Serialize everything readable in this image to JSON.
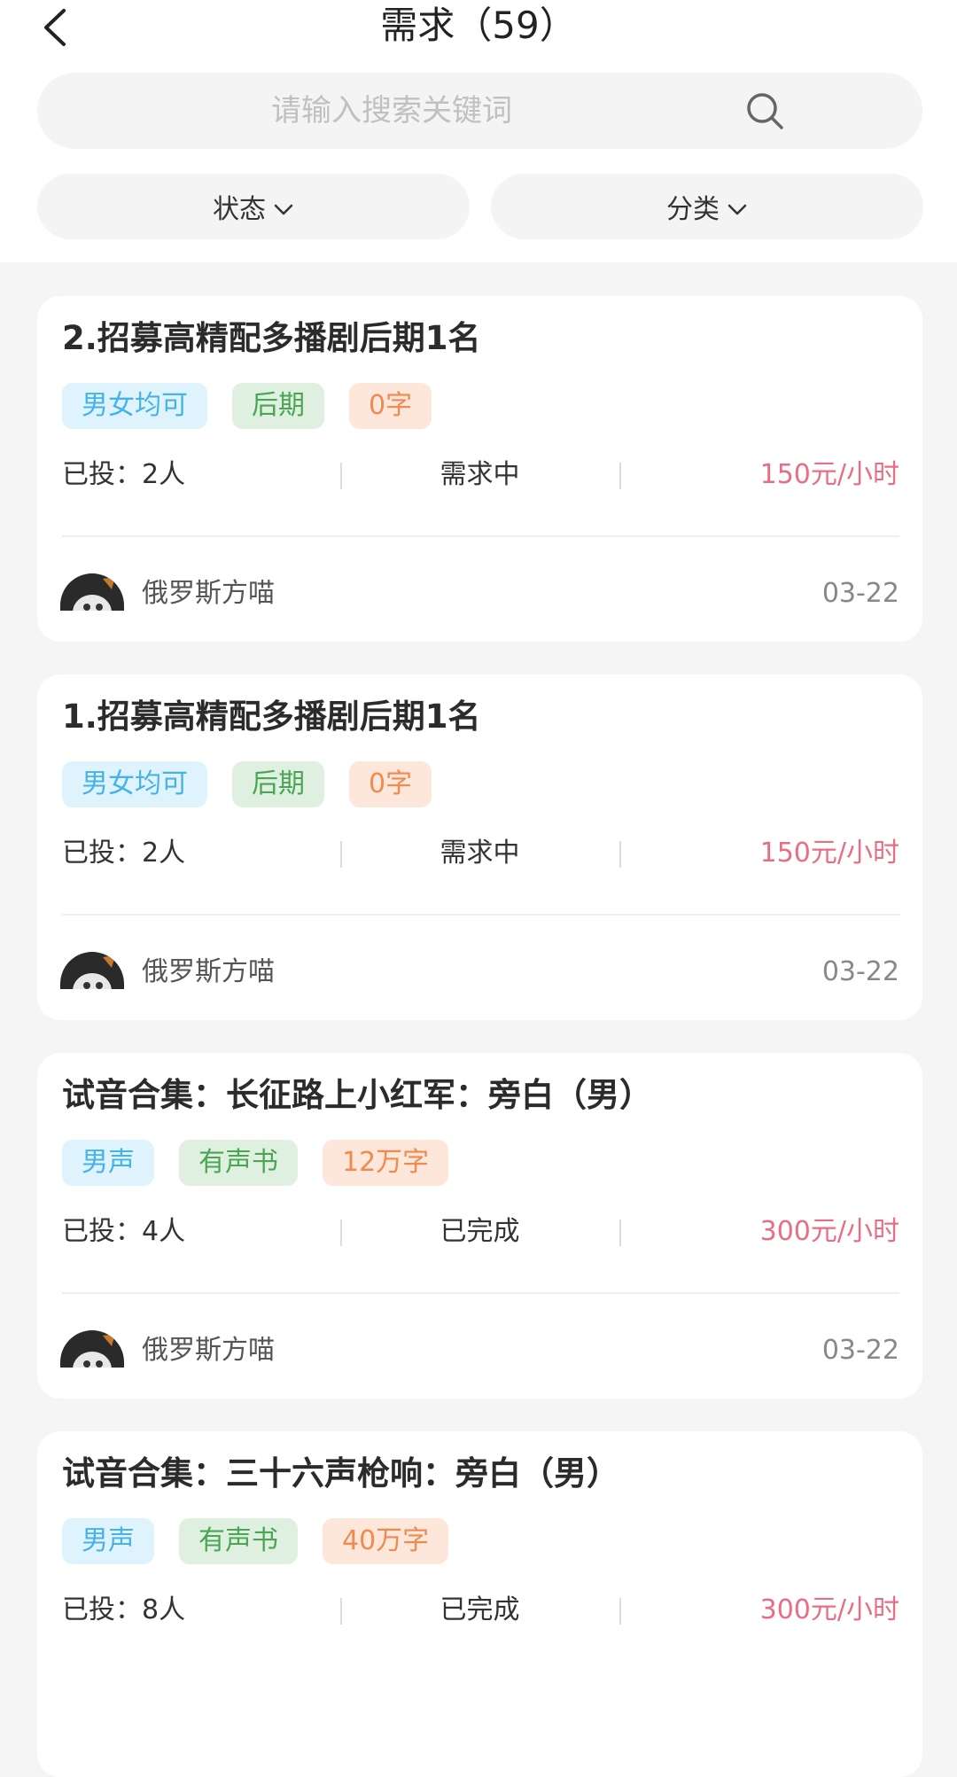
{
  "header": {
    "title": "需求（59）",
    "back_icon": "chevron-left-icon"
  },
  "search": {
    "placeholder": "请输入搜索关键词",
    "icon": "search-icon"
  },
  "filters": {
    "status_label": "状态",
    "category_label": "分类",
    "chevron_icon": "chevron-down-icon"
  },
  "colors": {
    "price": "#e86d85",
    "tag_blue": "#45b2e8",
    "tag_green": "#4aa554",
    "tag_orange": "#f08a4f"
  },
  "cards": [
    {
      "title": "2.招募高精配多播剧后期1名",
      "tags": [
        "男女均可",
        "后期",
        "0字"
      ],
      "applied": "已投：2人",
      "status": "需求中",
      "price": "150元/小时",
      "author": "俄罗斯方喵",
      "date": "03-22"
    },
    {
      "title": "1.招募高精配多播剧后期1名",
      "tags": [
        "男女均可",
        "后期",
        "0字"
      ],
      "applied": "已投：2人",
      "status": "需求中",
      "price": "150元/小时",
      "author": "俄罗斯方喵",
      "date": "03-22"
    },
    {
      "title": "试音合集：长征路上小红军：旁白（男）",
      "tags": [
        "男声",
        "有声书",
        "12万字"
      ],
      "applied": "已投：4人",
      "status": "已完成",
      "price": "300元/小时",
      "author": "俄罗斯方喵",
      "date": "03-22"
    },
    {
      "title": "试音合集：三十六声枪响：旁白（男）",
      "tags": [
        "男声",
        "有声书",
        "40万字"
      ],
      "applied": "已投：8人",
      "status": "已完成",
      "price": "300元/小时",
      "author": "",
      "date": ""
    }
  ]
}
